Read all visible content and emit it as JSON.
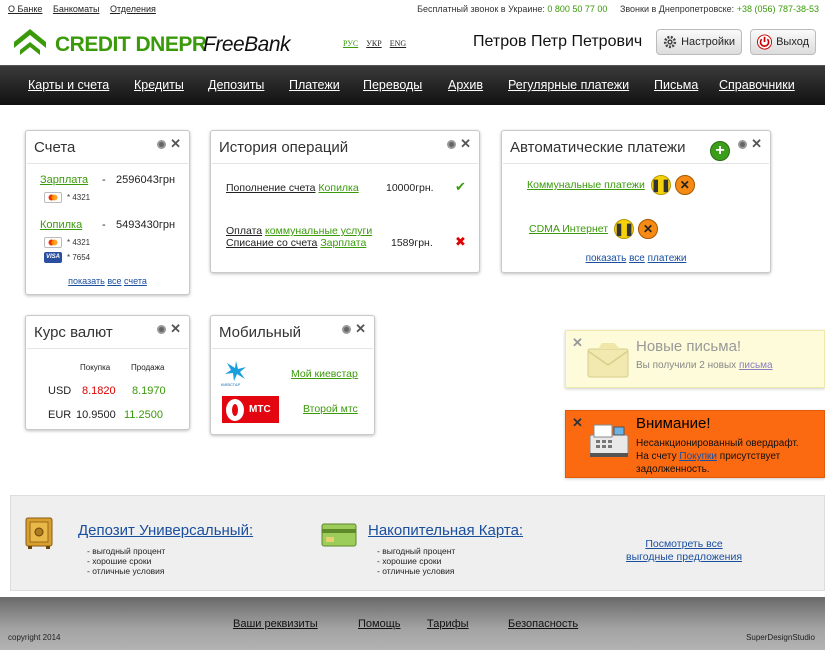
{
  "top_links": [
    "О Банке",
    "Банкоматы",
    "Отделения"
  ],
  "phones": {
    "ua_label": "Бесплатный звонок в Украине:",
    "ua_number": "0 800 50 77 00",
    "dnepr_label": "Звонки в Днепропетровске:",
    "dnepr_number": "+38 (056) 787-38-53"
  },
  "brand": {
    "name": "CREDIT DNEPR",
    "product": "FreeBank",
    "color": "#3a9a0a"
  },
  "languages": [
    "РУС",
    "УКР",
    "ENG"
  ],
  "user": {
    "name": "Петров Петр Петрович"
  },
  "buttons": {
    "settings": "Настройки",
    "exit": "Выход"
  },
  "nav": [
    "Карты и счета",
    "Кредиты",
    "Депозиты",
    "Платежи",
    "Переводы",
    "Архив",
    "Регулярные платежи",
    "Письма",
    "Справочники"
  ],
  "accounts": {
    "title": "Счета",
    "items": [
      {
        "name": "Зарплата",
        "dash": "-",
        "amount": "2596043грн",
        "cards": [
          "* 4321"
        ]
      },
      {
        "name": "Копилка",
        "dash": "-",
        "amount": "5493430грн",
        "cards": [
          "* 4321",
          "* 7654"
        ]
      }
    ],
    "footer": {
      "w1": "показать",
      "w2": "все",
      "w3": "счета"
    }
  },
  "history": {
    "title": "История операций",
    "ops": [
      {
        "text": "Пополнение счета",
        "link": "Копилка",
        "amount": "10000грн.",
        "status": "✔"
      },
      {
        "line1_text": "Оплата",
        "line1_link": "коммунальные услуги",
        "line2_text": "Списание со счета",
        "line2_link": "Зарплата",
        "amount": "1589грн.",
        "status": "✖"
      }
    ]
  },
  "autopay": {
    "title": "Автоматические платежи",
    "items": [
      "Коммунальные платежи",
      "CDMA Интернет"
    ],
    "footer": {
      "w1": "показать",
      "w2": "все",
      "w3": "платежи"
    }
  },
  "rates": {
    "title": "Курс валют",
    "headers": [
      "Покупка",
      "Продажа"
    ],
    "rows": [
      {
        "cur": "USD",
        "buy": "8.1820",
        "sell": "8.1970"
      },
      {
        "cur": "EUR",
        "buy": "10.9500",
        "sell": "11.2500"
      }
    ]
  },
  "mobile": {
    "title": "Мобильный",
    "operators": [
      {
        "logo_text": "КИЇВСТАР",
        "link": "Мой киевстар"
      },
      {
        "logo_text": "МТС",
        "link": "Второй мтс"
      }
    ]
  },
  "notices": {
    "mail": {
      "title": "Новые письма!",
      "text": "Вы получили 2 новых",
      "link": "письма"
    },
    "warning": {
      "title": "Внимание!",
      "line1": "Несанкционированный овердрафт.",
      "line2_pre": "На счету",
      "line2_link": "Покупки",
      "line2_post": "присутствует",
      "line3": "задолженность."
    }
  },
  "promo": {
    "deposit": {
      "title": "Депозит Универсальный:",
      "bullets": [
        "выгодный процент",
        "хорошие сроки",
        "отличные условия"
      ]
    },
    "card": {
      "title": "Накопительная Карта:",
      "bullets": [
        "выгодный процент",
        "хорошие сроки",
        "отличные условия"
      ]
    },
    "more_line1": "Посмотреть все",
    "more_line2": "выгодные предложения"
  },
  "footer": {
    "links": [
      "Ваши реквизиты",
      "Помощь",
      "Тарифы",
      "Безопасность"
    ],
    "copyright": "copyright 2014",
    "studio": "SuperDesignStudio"
  }
}
